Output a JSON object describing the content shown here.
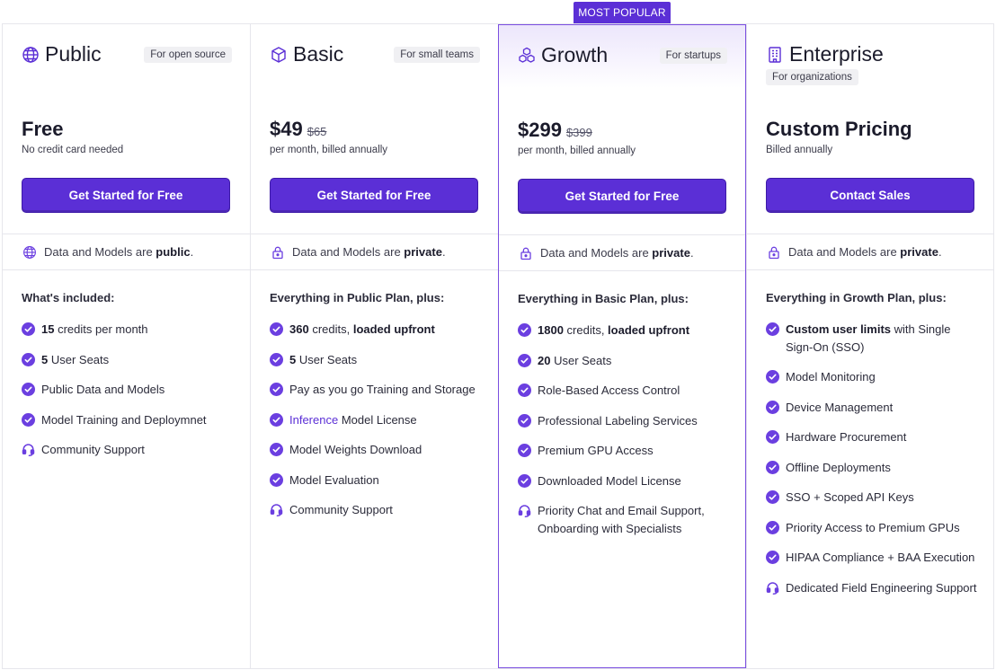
{
  "badge": "MOST POPULAR",
  "colors": {
    "accent": "#5b2fd6",
    "border": "#e6e6ec",
    "tag_bg": "#f0f0f3"
  },
  "plans": [
    {
      "icon": "globe-icon",
      "name": "Public",
      "tag": "For open source",
      "price": "Free",
      "price_old": "",
      "price_sub": "No credit card needed",
      "cta": "Get Started for Free",
      "privacy_icon": "globe-icon",
      "privacy_prefix": "Data and Models are ",
      "privacy_value": "public",
      "privacy_suffix": ".",
      "includes_title": "What's included:",
      "features": [
        {
          "icon": "check-circle-icon",
          "bold": "15",
          "text": " credits per month"
        },
        {
          "icon": "check-circle-icon",
          "bold": "5",
          "text": " User Seats"
        },
        {
          "icon": "check-circle-icon",
          "bold": "",
          "text": "Public Data and Models"
        },
        {
          "icon": "check-circle-icon",
          "bold": "",
          "text": "Model Training and Deploymnet"
        },
        {
          "icon": "headset-icon",
          "bold": "",
          "text": "Community Support"
        }
      ]
    },
    {
      "icon": "cube-icon",
      "name": "Basic",
      "tag": "For small teams",
      "price": "$49",
      "price_old": "$65",
      "price_sub": "per month, billed annually",
      "cta": "Get Started for Free",
      "privacy_icon": "lock-icon",
      "privacy_prefix": "Data and Models are ",
      "privacy_value": "private",
      "privacy_suffix": ".",
      "includes_title": "Everything in Public Plan, plus:",
      "features": [
        {
          "icon": "check-circle-icon",
          "bold": "360",
          "text": " credits, ",
          "bold2": "loaded upfront"
        },
        {
          "icon": "check-circle-icon",
          "bold": "5",
          "text": " User Seats"
        },
        {
          "icon": "check-circle-icon",
          "bold": "",
          "text": "Pay as you go Training and Storage"
        },
        {
          "icon": "check-circle-icon",
          "accent": "Inference",
          "text": " Model License"
        },
        {
          "icon": "check-circle-icon",
          "bold": "",
          "text": "Model Weights Download"
        },
        {
          "icon": "check-circle-icon",
          "bold": "",
          "text": "Model Evaluation"
        },
        {
          "icon": "headset-icon",
          "bold": "",
          "text": "Community Support"
        }
      ]
    },
    {
      "icon": "boxes-icon",
      "name": "Growth",
      "tag": "For startups",
      "price": "$299",
      "price_old": "$399",
      "price_sub": "per month, billed annually",
      "cta": "Get Started for Free",
      "privacy_icon": "lock-icon",
      "privacy_prefix": "Data and Models are ",
      "privacy_value": "private",
      "privacy_suffix": ".",
      "includes_title": "Everything in Basic Plan, plus:",
      "features": [
        {
          "icon": "check-circle-icon",
          "bold": "1800",
          "text": " credits, ",
          "bold2": "loaded upfront"
        },
        {
          "icon": "check-circle-icon",
          "bold": "20",
          "text": " User Seats"
        },
        {
          "icon": "check-circle-icon",
          "bold": "",
          "text": "Role-Based Access Control"
        },
        {
          "icon": "check-circle-icon",
          "bold": "",
          "text": "Professional Labeling Services"
        },
        {
          "icon": "check-circle-icon",
          "bold": "",
          "text": "Premium GPU Access"
        },
        {
          "icon": "check-circle-icon",
          "bold": "",
          "text": "Downloaded Model License"
        },
        {
          "icon": "headset-icon",
          "bold": "",
          "text": "Priority Chat and Email Support, Onboarding with Specialists"
        }
      ]
    },
    {
      "icon": "building-icon",
      "name": "Enterprise",
      "tag": "For organizations",
      "price": "Custom Pricing",
      "price_old": "",
      "price_sub": "Billed annually",
      "cta": "Contact Sales",
      "privacy_icon": "lock-icon",
      "privacy_prefix": "Data and Models are ",
      "privacy_value": "private",
      "privacy_suffix": ".",
      "includes_title": "Everything in Growth Plan, plus:",
      "features": [
        {
          "icon": "check-circle-icon",
          "bold": "Custom user limits",
          "text": " with Single Sign-On (SSO)"
        },
        {
          "icon": "check-circle-icon",
          "bold": "",
          "text": "Model Monitoring"
        },
        {
          "icon": "check-circle-icon",
          "bold": "",
          "text": "Device Management"
        },
        {
          "icon": "check-circle-icon",
          "bold": "",
          "text": "Hardware Procurement"
        },
        {
          "icon": "check-circle-icon",
          "bold": "",
          "text": "Offline Deployments"
        },
        {
          "icon": "check-circle-icon",
          "bold": "",
          "text": "SSO + Scoped API Keys"
        },
        {
          "icon": "check-circle-icon",
          "bold": "",
          "text": "Priority Access to Premium GPUs"
        },
        {
          "icon": "check-circle-icon",
          "bold": "",
          "text": "HIPAA Compliance + BAA Execution"
        },
        {
          "icon": "headset-icon",
          "bold": "",
          "text": "Dedicated Field Engineering Support"
        }
      ]
    }
  ]
}
